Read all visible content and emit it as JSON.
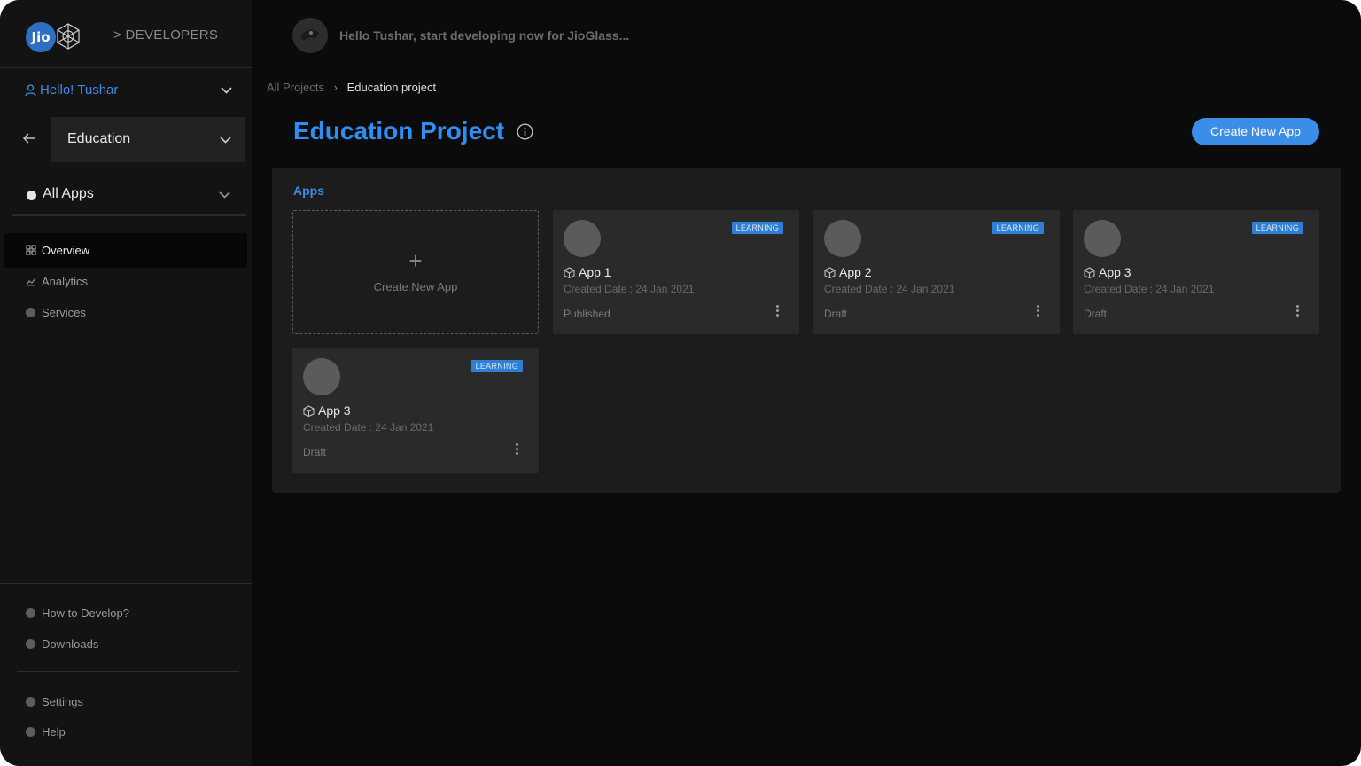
{
  "brand": {
    "logo_text": "Jio",
    "section_label": "> DEVELOPERS"
  },
  "user": {
    "greeting": "Hello! Tushar"
  },
  "project_selector": {
    "value": "Education"
  },
  "app_filter": {
    "value": "All Apps"
  },
  "nav": {
    "items": [
      {
        "label": "Overview",
        "icon": "overview-icon",
        "active": true
      },
      {
        "label": "Analytics",
        "icon": "analytics-icon",
        "active": false
      },
      {
        "label": "Services",
        "icon": "services-icon",
        "active": false
      }
    ],
    "bottom": [
      {
        "label": "How to Develop?",
        "icon": "help-circle-icon"
      },
      {
        "label": "Downloads",
        "icon": "downloads-icon"
      }
    ],
    "footer": [
      {
        "label": "Settings",
        "icon": "settings-icon"
      },
      {
        "label": "Help",
        "icon": "help-icon"
      }
    ]
  },
  "header": {
    "welcome": "Hello Tushar, start developing now for JioGlass..."
  },
  "breadcrumb": {
    "root": "All Projects",
    "current": "Education project"
  },
  "page": {
    "title": "Education Project",
    "create_button": "Create New App"
  },
  "apps_section": {
    "title": "Apps",
    "new_card_label": "Create New App",
    "cards": [
      {
        "badge": "LEARNING",
        "name": "App 1",
        "date": "Created Date : 24 Jan 2021",
        "status": "Published"
      },
      {
        "badge": "LEARNING",
        "name": "App 2",
        "date": "Created Date : 24 Jan 2021",
        "status": "Draft"
      },
      {
        "badge": "LEARNING",
        "name": "App 3",
        "date": "Created Date : 24 Jan 2021",
        "status": "Draft"
      },
      {
        "badge": "LEARNING",
        "name": "App 3",
        "date": "Created Date : 24 Jan 2021",
        "status": "Draft"
      }
    ]
  },
  "colors": {
    "accent": "#3b8ee8",
    "background": "#0b0b0b",
    "sidebar": "#131313",
    "card": "#2a2a2a"
  }
}
